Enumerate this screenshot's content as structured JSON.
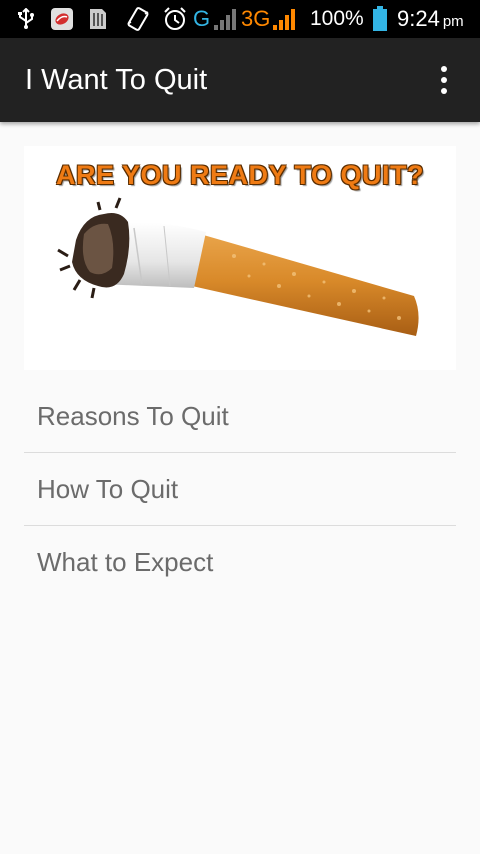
{
  "status_bar": {
    "icons": [
      "usb-icon",
      "notification-app-icon",
      "sim-card-icon",
      "vibrate-icon",
      "alarm-icon",
      "signal-icon",
      "signal-3g-icon",
      "battery-icon"
    ],
    "network_g": "G",
    "network_3g": "3G",
    "battery_percent": "100%",
    "time": "9:24",
    "ampm": "pm",
    "colors": {
      "g": "#33b5e5",
      "threeg": "#ff8800"
    }
  },
  "app_bar": {
    "title": "I Want To Quit",
    "overflow_icon": "more-vert-icon"
  },
  "banner": {
    "heading": "ARE YOU READY TO QUIT?",
    "image_subject": "cigarette-butt"
  },
  "menu": {
    "items": [
      {
        "label": "Reasons To Quit"
      },
      {
        "label": "How To Quit"
      },
      {
        "label": "What to Expect"
      }
    ]
  },
  "colors": {
    "app_bar": "#222222",
    "background": "#fafafa",
    "menu_text": "#6b6b6b",
    "banner_heading": "#ef7b14"
  }
}
